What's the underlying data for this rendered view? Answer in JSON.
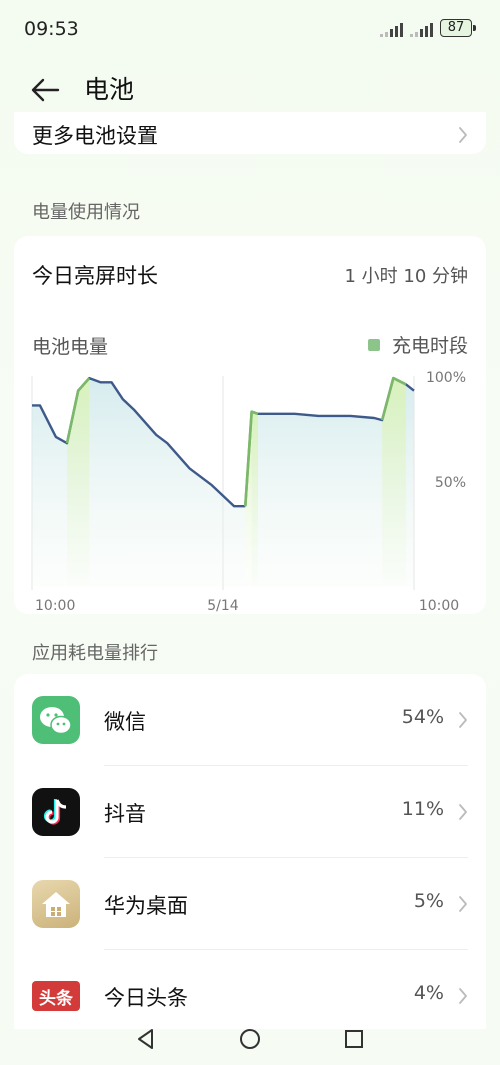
{
  "status_bar": {
    "time": "09:53",
    "battery": "87"
  },
  "header": {
    "title": "电池"
  },
  "more_settings": {
    "label": "更多电池设置"
  },
  "usage_section": {
    "label": "电量使用情况"
  },
  "screen_time": {
    "label": "今日亮屏时长",
    "value": "1 小时 10 分钟"
  },
  "chart_data": {
    "type": "area",
    "title": "电池电量",
    "legend": [
      {
        "name": "充电时段",
        "color": "#8cc48a"
      }
    ],
    "y_tick_labels": [
      "100%",
      "50%"
    ],
    "ylim": [
      0,
      100
    ],
    "x_tick_labels": [
      "10:00",
      "5/14",
      "10:00"
    ],
    "x_unit": "hours since first 10:00 tick (0–24)",
    "series": [
      {
        "name": "battery_level",
        "x": [
          0,
          0.5,
          1.5,
          2.2,
          2.9,
          3.6,
          4.3,
          5.0,
          5.7,
          6.4,
          7.1,
          7.8,
          8.5,
          9.2,
          9.9,
          10.6,
          11.3,
          12.0,
          12.7,
          13.4,
          13.8,
          14.2,
          15.0,
          16.5,
          18.0,
          20.0,
          21.5,
          22.0,
          22.7,
          23.5,
          24.0
        ],
        "y": [
          86,
          86,
          71,
          68,
          93,
          99,
          97,
          97,
          89,
          84,
          78,
          72,
          68,
          62,
          56,
          52,
          48,
          43,
          38,
          38,
          83,
          82,
          82,
          82,
          81,
          81,
          80,
          79,
          99,
          96,
          93
        ]
      }
    ],
    "charging_periods": [
      [
        2.2,
        3.6
      ],
      [
        13.4,
        14.2
      ],
      [
        22.0,
        23.5
      ]
    ],
    "line_color": "#3d5a8a",
    "charging_line_color": "#7cb86a"
  },
  "ranking_section": {
    "label": "应用耗电量排行"
  },
  "apps": [
    {
      "name": "微信",
      "percent": "54%",
      "icon": "wechat-icon"
    },
    {
      "name": "抖音",
      "percent": "11%",
      "icon": "douyin-icon"
    },
    {
      "name": "华为桌面",
      "percent": "5%",
      "icon": "huawei-launcher-icon"
    },
    {
      "name": "今日头条",
      "percent": "4%",
      "icon": "toutiao-icon",
      "icon_text": "头条"
    }
  ],
  "colors": {
    "accent_green": "#8cc48a",
    "wechat": "#4fbf77",
    "douyin": "#111111",
    "launcher": "#d9c69a",
    "toutiao": "#d33b3b"
  }
}
